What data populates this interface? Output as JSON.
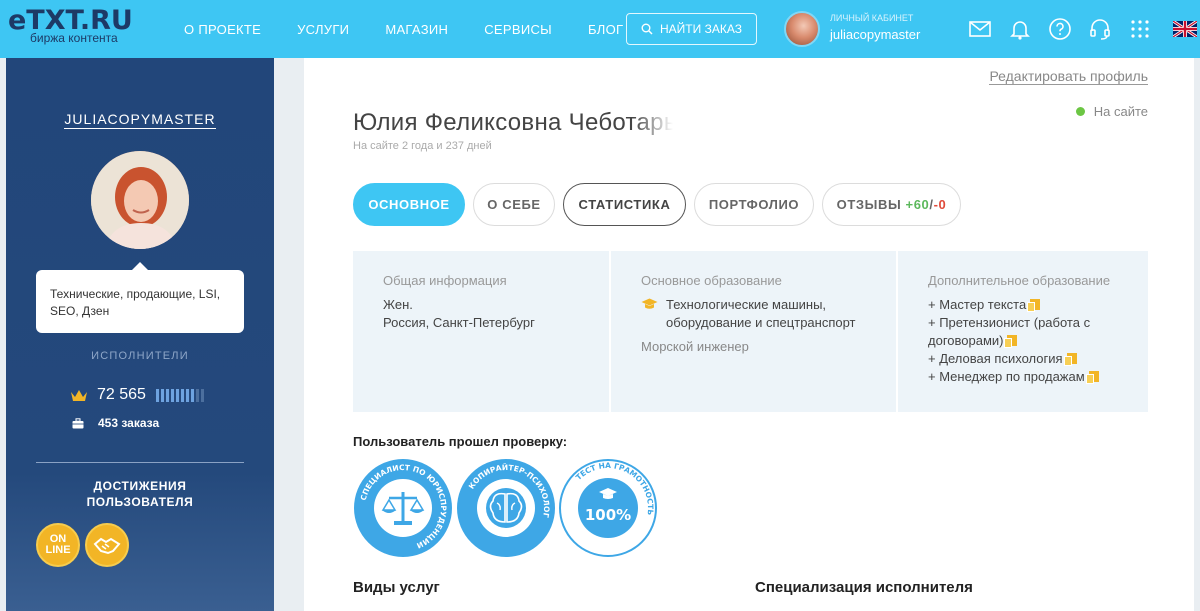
{
  "header": {
    "logo": "eTXT.RU",
    "tagline": "биржа контента",
    "nav": [
      "О ПРОЕКТЕ",
      "УСЛУГИ",
      "МАГАЗИН",
      "СЕРВИСЫ",
      "БЛОГ"
    ],
    "find_button": "НАЙТИ ЗАКАЗ",
    "cabinet_label": "ЛИЧНЫЙ КАБИНЕТ",
    "cabinet_user": "juliacopymaster",
    "icons": [
      "mail-icon",
      "bell-icon",
      "help-icon",
      "support-headset-icon",
      "apps-grid-icon",
      "uk-flag-icon"
    ]
  },
  "sidebar": {
    "username": "JULIACOPYMASTER",
    "tooltip": "Технические, продающие, LSI, SEO, Дзен",
    "role": "ИСПОЛНИТЕЛИ",
    "rating": "72 565",
    "rating_level": 0.8,
    "orders": "453 заказа",
    "achievements_title_1": "ДОСТИЖЕНИЯ",
    "achievements_title_2": "ПОЛЬЗОВАТЕЛЯ",
    "badge_online_1": "ON",
    "badge_online_2": "LINE"
  },
  "profile": {
    "edit_link": "Редактировать профиль",
    "status": "На сайте",
    "full_name": "Юлия Феликсовна Чеботарь",
    "since": "На сайте 2 года и 237 дней",
    "tabs": {
      "main": "ОСНОВНОЕ",
      "about": "О СЕБЕ",
      "stats": "СТАТИСТИКА",
      "portfolio": "ПОРТФОЛИО",
      "reviews_label": "ОТЗЫВЫ ",
      "reviews_pos": "+60",
      "reviews_sep": "/",
      "reviews_neg": "-0"
    },
    "general": {
      "title": "Общая информация",
      "gender": "Жен.",
      "location": "Россия, Санкт-Петербург"
    },
    "education": {
      "title": "Основное образование",
      "field_1": "Технологические машины,",
      "field_2": "оборудование и спецтранспорт",
      "qualification": "Морской инженер"
    },
    "extra_education": {
      "title": "Дополнительное образование",
      "items": [
        "+ Мастер текста",
        "+ Претензионист (работа с",
        "договорами)",
        "+ Деловая психология",
        "+ Менеджер по продажам"
      ]
    },
    "verified_title": "Пользователь прошел проверку:",
    "seals": {
      "law": "СПЕЦИАЛИСТ ПО ЮРИСПРУДЕНЦИИ",
      "psych": "КОПИРАЙТЕР-ПСИХОЛОГ",
      "literacy": "ТЕСТ НА ГРАМОТНОСТЬ",
      "percent": "100%"
    },
    "services_heading": "Виды услуг",
    "specialization_heading": "Специализация исполнителя"
  },
  "colors": {
    "accent": "#3ec6f3",
    "sidebar": "#22467a",
    "gold": "#f2b526",
    "online": "#6cc644"
  }
}
